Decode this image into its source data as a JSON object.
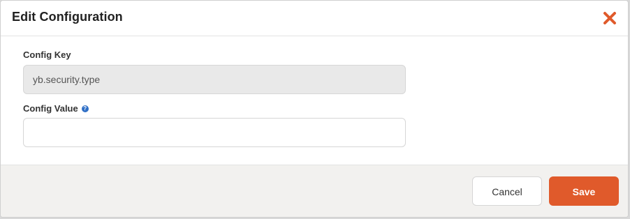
{
  "modal": {
    "title": "Edit Configuration",
    "close_icon": "close-icon",
    "accent_color": "#e05a2b"
  },
  "fields": {
    "config_key": {
      "label": "Config Key",
      "value": "yb.security.type"
    },
    "config_value": {
      "label": "Config Value",
      "help_icon": "help-icon",
      "help_glyph": "?",
      "value": "",
      "placeholder": ""
    }
  },
  "footer": {
    "cancel_label": "Cancel",
    "save_label": "Save"
  }
}
